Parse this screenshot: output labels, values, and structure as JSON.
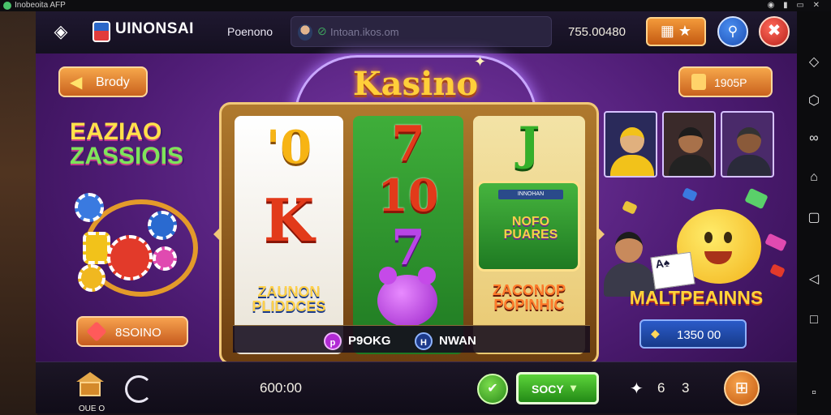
{
  "statusbar": {
    "app_name": "Inobeoita AFP",
    "sys_icons": "◉ ▮ ▭ ✕"
  },
  "topbar": {
    "brand_name": "UINONSAI",
    "brand_sub": "",
    "player_name": "Poenono",
    "search_text": "Intoan.ikos.om",
    "balance": "755.00480",
    "shop_icon": "▦ ★",
    "search_icon": "⚲",
    "close_icon": "✖"
  },
  "title": "Kasino",
  "left": {
    "body_button": "Brody",
    "promo_line1": "EAZIAO",
    "promo_line2": "ZASSIOIS",
    "bottom_button": "8SOINO"
  },
  "right": {
    "reward_button": "1905P",
    "promo_title": "MALTPEAINNS",
    "cards_label": "A♠",
    "bottom_button": "1350 00"
  },
  "reels": {
    "r1_top": "'0",
    "r1_mid": "K",
    "r1_bottom": "ZAUNON PLIDDCES",
    "r2_top": "7",
    "r2_mid": "10",
    "r2_low": "7",
    "r3_top": "J",
    "r3_card_tag": "INNOHAN",
    "r3_card_text": "NOFO PUARES",
    "r3_bottom": "ZACONOP POPINHIC"
  },
  "winbar": {
    "icon1": "p",
    "text1": "P9OKG",
    "icon2": "H",
    "text2": "NWAN"
  },
  "bottombar": {
    "home_label": "OUE O",
    "bet_amount": "600:00",
    "ok_icon": "✔",
    "spin_label": "SOCY",
    "spin_chevron": "▾",
    "star_icon": "✦",
    "stat_a": "6",
    "stat_b": "3",
    "menu_icon": "⊞"
  },
  "navbar": {
    "icons": [
      "◇",
      "⬡",
      "∞",
      "⌂",
      "▢",
      "◁",
      "□",
      "▫"
    ]
  },
  "colors": {
    "accent_purple": "#7a3aa8",
    "accent_orange": "#f39a3a",
    "spin_green": "#5cd43a"
  }
}
